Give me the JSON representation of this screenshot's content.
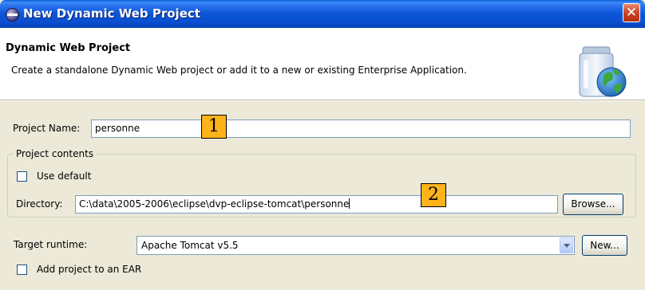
{
  "window": {
    "title": "New Dynamic Web Project",
    "close_glyph": "✕"
  },
  "banner": {
    "title": "Dynamic Web Project",
    "description": "Create a standalone Dynamic Web project or add it to a new or existing Enterprise Application.",
    "icon": "web-project-jar-globe-icon"
  },
  "form": {
    "project_name_label": "Project Name:",
    "project_name_value": "personne",
    "contents_group_title": "Project contents",
    "use_default_label": "Use default",
    "use_default_checked": false,
    "directory_label": "Directory:",
    "directory_value": "C:\\data\\2005-2006\\eclipse\\dvp-eclipse-tomcat\\personne",
    "browse_label": "Browse...",
    "target_runtime_label": "Target runtime:",
    "target_runtime_value": "Apache Tomcat v5.5",
    "new_label": "New...",
    "add_to_ear_label": "Add project to an EAR",
    "add_to_ear_checked": false
  },
  "annotations": {
    "marker1": "1",
    "marker2": "2",
    "color": "#ffb31a"
  }
}
